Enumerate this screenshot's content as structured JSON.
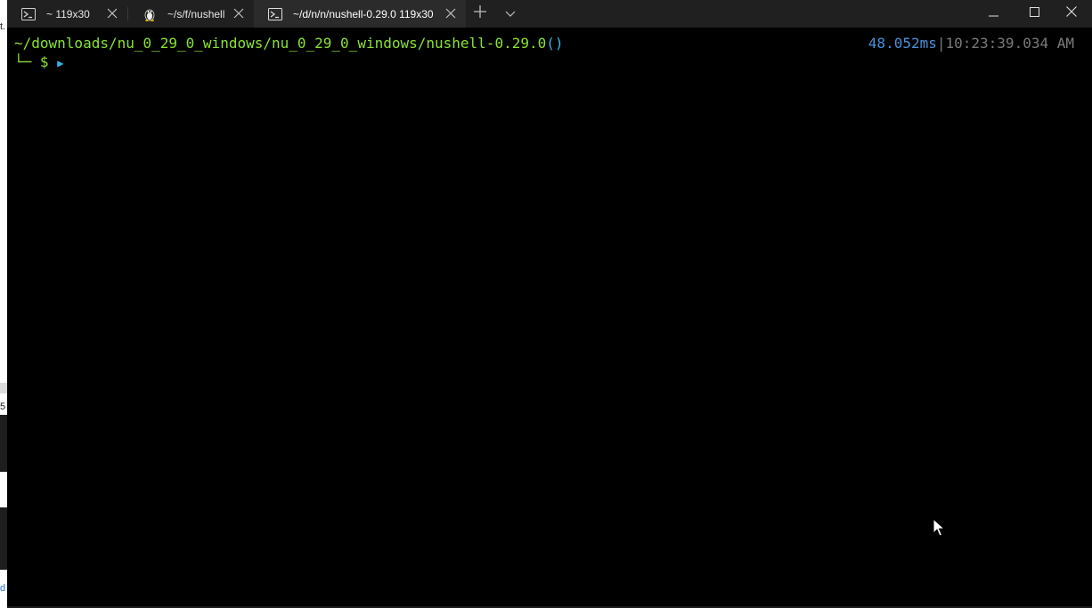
{
  "tabs": [
    {
      "label": "~ 119x30",
      "icon": "powershell-icon",
      "active": false
    },
    {
      "label": "~/s/f/nushell",
      "icon": "linux-penguin-icon",
      "active": false
    },
    {
      "label": "~/d/n/n/nushell-0.29.0 119x30",
      "icon": "powershell-icon",
      "active": true
    }
  ],
  "tabbar": {
    "new_tab_icon": "plus-icon",
    "dropdown_icon": "chevron-down-icon"
  },
  "window_controls": {
    "minimize_icon": "minimize-icon",
    "maximize_icon": "maximize-icon",
    "close_icon": "close-icon"
  },
  "terminal": {
    "cwd_path": "~/downloads/nu_0_29_0_windows/nu_0_29_0_windows/nushell-0.29.0",
    "cwd_parens": "()",
    "prompt_corner": "└─",
    "prompt_symbol": "$",
    "prompt_arrow": "▶",
    "duration": "48.052ms",
    "separator": "|",
    "timestamp": "10:23:39.034 AM"
  },
  "background_window": {
    "edge_marks": [
      "t.",
      "5",
      "d"
    ]
  },
  "colors": {
    "path": "#8ae234",
    "parens": "#34b6e6",
    "duration": "#4b8fd9",
    "timestamp": "#7a7a7a",
    "tabbar_bg": "#202020",
    "active_tab_bg": "#2b2b2b"
  }
}
